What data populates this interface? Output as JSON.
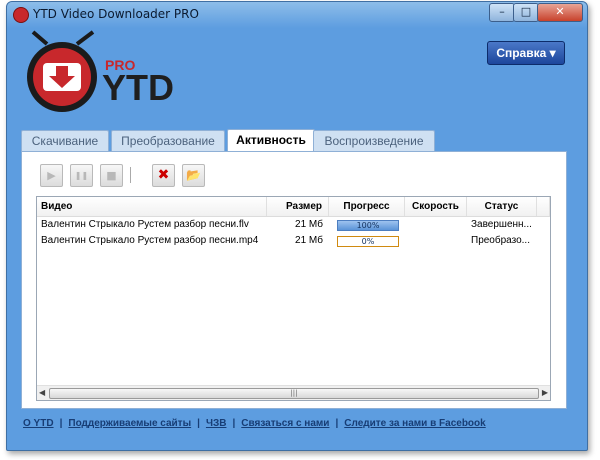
{
  "window": {
    "title": "YTD Video Downloader PRO",
    "icon": "ytd-app-icon"
  },
  "window_controls": {
    "minimize": "–",
    "maximize": "□",
    "close": "✕"
  },
  "logo": {
    "pro": "PRO",
    "name": "YTD"
  },
  "help_button": {
    "label": "Справка"
  },
  "tabs": [
    {
      "label": "Скачивание",
      "active": false
    },
    {
      "label": "Преобразование",
      "active": false
    },
    {
      "label": "Активность",
      "active": true
    },
    {
      "label": "Воспроизведение",
      "active": false
    }
  ],
  "toolbar": {
    "play": {
      "icon": "play-icon",
      "glyph": "▶",
      "enabled": false
    },
    "pause": {
      "icon": "pause-icon",
      "glyph": "❚❚",
      "enabled": false
    },
    "stop": {
      "icon": "stop-icon",
      "glyph": "■",
      "enabled": false
    },
    "delete": {
      "icon": "delete-x-icon",
      "glyph": "✖",
      "enabled": true
    },
    "open_folder": {
      "icon": "folder-icon",
      "glyph": "📂",
      "enabled": true
    }
  },
  "table": {
    "headers": {
      "video": "Видео",
      "size": "Размер",
      "progress": "Прогресс",
      "speed": "Скорость",
      "status": "Статус"
    },
    "rows": [
      {
        "video": "Валентин Стрыкало Рустем разбор песни.flv",
        "size": "21 Мб",
        "progress_text": "100%",
        "progress": 100,
        "speed": "",
        "status": "Завершенн..."
      },
      {
        "video": "Валентин Стрыкало Рустем разбор песни.mp4",
        "size": "21 Мб",
        "progress_text": "0%",
        "progress": 0,
        "speed": "",
        "status": "Преобразо..."
      }
    ]
  },
  "scrollbar": {
    "left": "◀",
    "right": "▶",
    "grip": "|||"
  },
  "footer": {
    "links": [
      "О YTD",
      "Поддерживаемые сайты",
      "ЧЗВ",
      "Связаться с нами",
      "Следите за нами в Facebook"
    ],
    "separator": "|"
  },
  "colors": {
    "window_blue": "#5d9de0",
    "help_button": "#1d469c",
    "logo_red": "#c8282c",
    "progress_fill": "#5b94d8",
    "progress_border_pending": "#d08a10"
  }
}
